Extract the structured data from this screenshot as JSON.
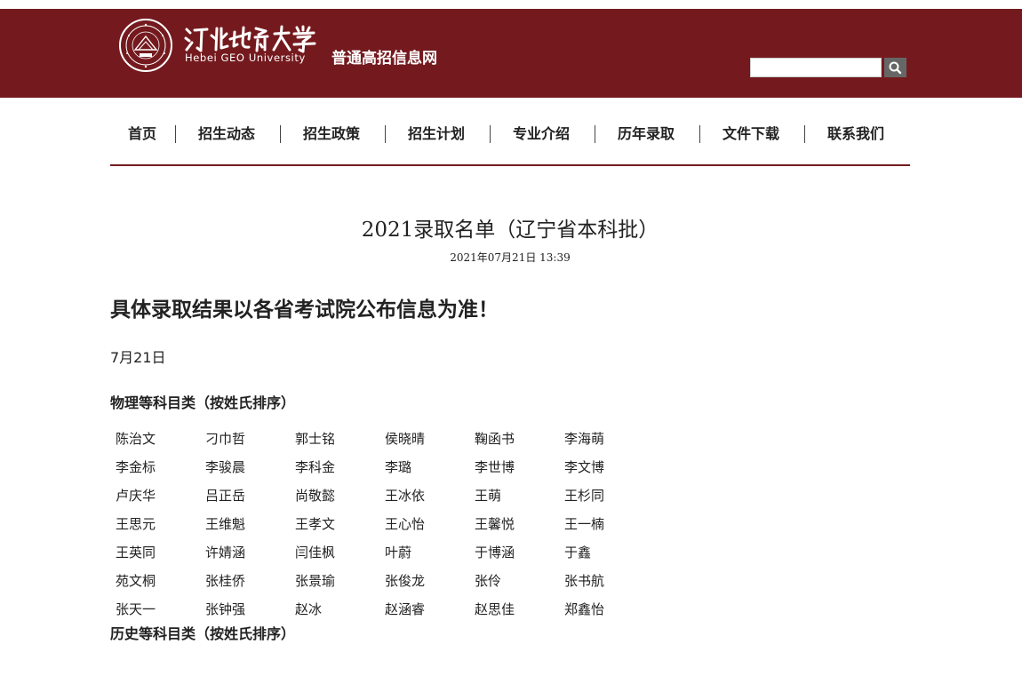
{
  "header": {
    "logo_seal_text": "河北地质大学 Hebei GEO University 1953",
    "logo_cn": "河北地质大学",
    "logo_en": "Hebei GEO University",
    "site_title": "普通高招信息网",
    "search": {
      "value": "",
      "placeholder": ""
    },
    "colors": {
      "band": "#741a1e",
      "search_button": "#666666"
    }
  },
  "nav": {
    "items": [
      {
        "label": "首页"
      },
      {
        "label": "招生动态"
      },
      {
        "label": "招生政策"
      },
      {
        "label": "招生计划"
      },
      {
        "label": "专业介绍"
      },
      {
        "label": "历年录取"
      },
      {
        "label": "文件下载"
      },
      {
        "label": "联系我们"
      }
    ]
  },
  "article": {
    "title": "2021录取名单（辽宁省本科批）",
    "date": "2021年07月21日 13:39",
    "notice": "具体录取结果以各省考试院公布信息为准！",
    "date_line": "7月21日",
    "physics_title": "物理等科目类（按姓氏排序）",
    "physics_names": [
      [
        "陈治文",
        "刁巾哲",
        "郭士铭",
        "侯晓晴",
        "鞠函书",
        "李海萌"
      ],
      [
        "李金标",
        "李骏晨",
        "李科金",
        "李璐",
        "李世博",
        "李文博"
      ],
      [
        "卢庆华",
        "吕正岳",
        "尚敬懿",
        "王冰依",
        "王萌",
        "王杉同"
      ],
      [
        "王思元",
        "王维魁",
        "王孝文",
        "王心怡",
        "王馨悦",
        "王一楠"
      ],
      [
        "王英同",
        "许婧涵",
        "闫佳枫",
        "叶蔚",
        "于博涵",
        "于鑫"
      ],
      [
        "苑文桐",
        "张桂侨",
        "张景瑜",
        "张俊龙",
        "张伶",
        "张书航"
      ],
      [
        "张天一",
        "张钟强",
        "赵冰",
        "赵涵睿",
        "赵思佳",
        "郑鑫怡"
      ]
    ],
    "history_title": "历史等科目类（按姓氏排序）",
    "history_names": [
      [
        "",
        "",
        "",
        "",
        "",
        ""
      ]
    ]
  }
}
